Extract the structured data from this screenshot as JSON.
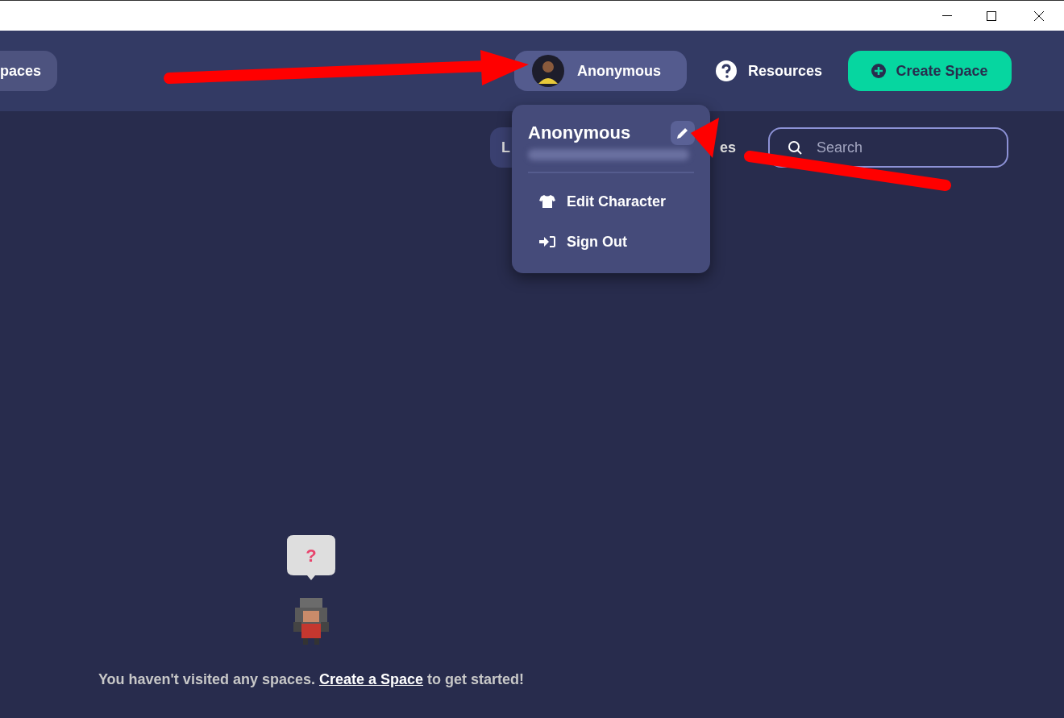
{
  "header": {
    "nav_pill": "paces",
    "user_button": {
      "name": "Anonymous",
      "expanded": true
    },
    "resources": "Resources",
    "create_button": "Create Space"
  },
  "toolbar": {
    "tab_fragment": "L",
    "text_fragment": "es",
    "search": {
      "placeholder": "Search"
    }
  },
  "user_menu": {
    "name": "Anonymous",
    "items": [
      {
        "kind": "character",
        "label": "Edit Character"
      },
      {
        "kind": "sign_out",
        "label": "Sign Out"
      }
    ]
  },
  "empty_state": {
    "bubble": "?",
    "message_before": "You haven't visited any spaces.",
    "link": "Create a Space",
    "message_after": "to get started!"
  }
}
